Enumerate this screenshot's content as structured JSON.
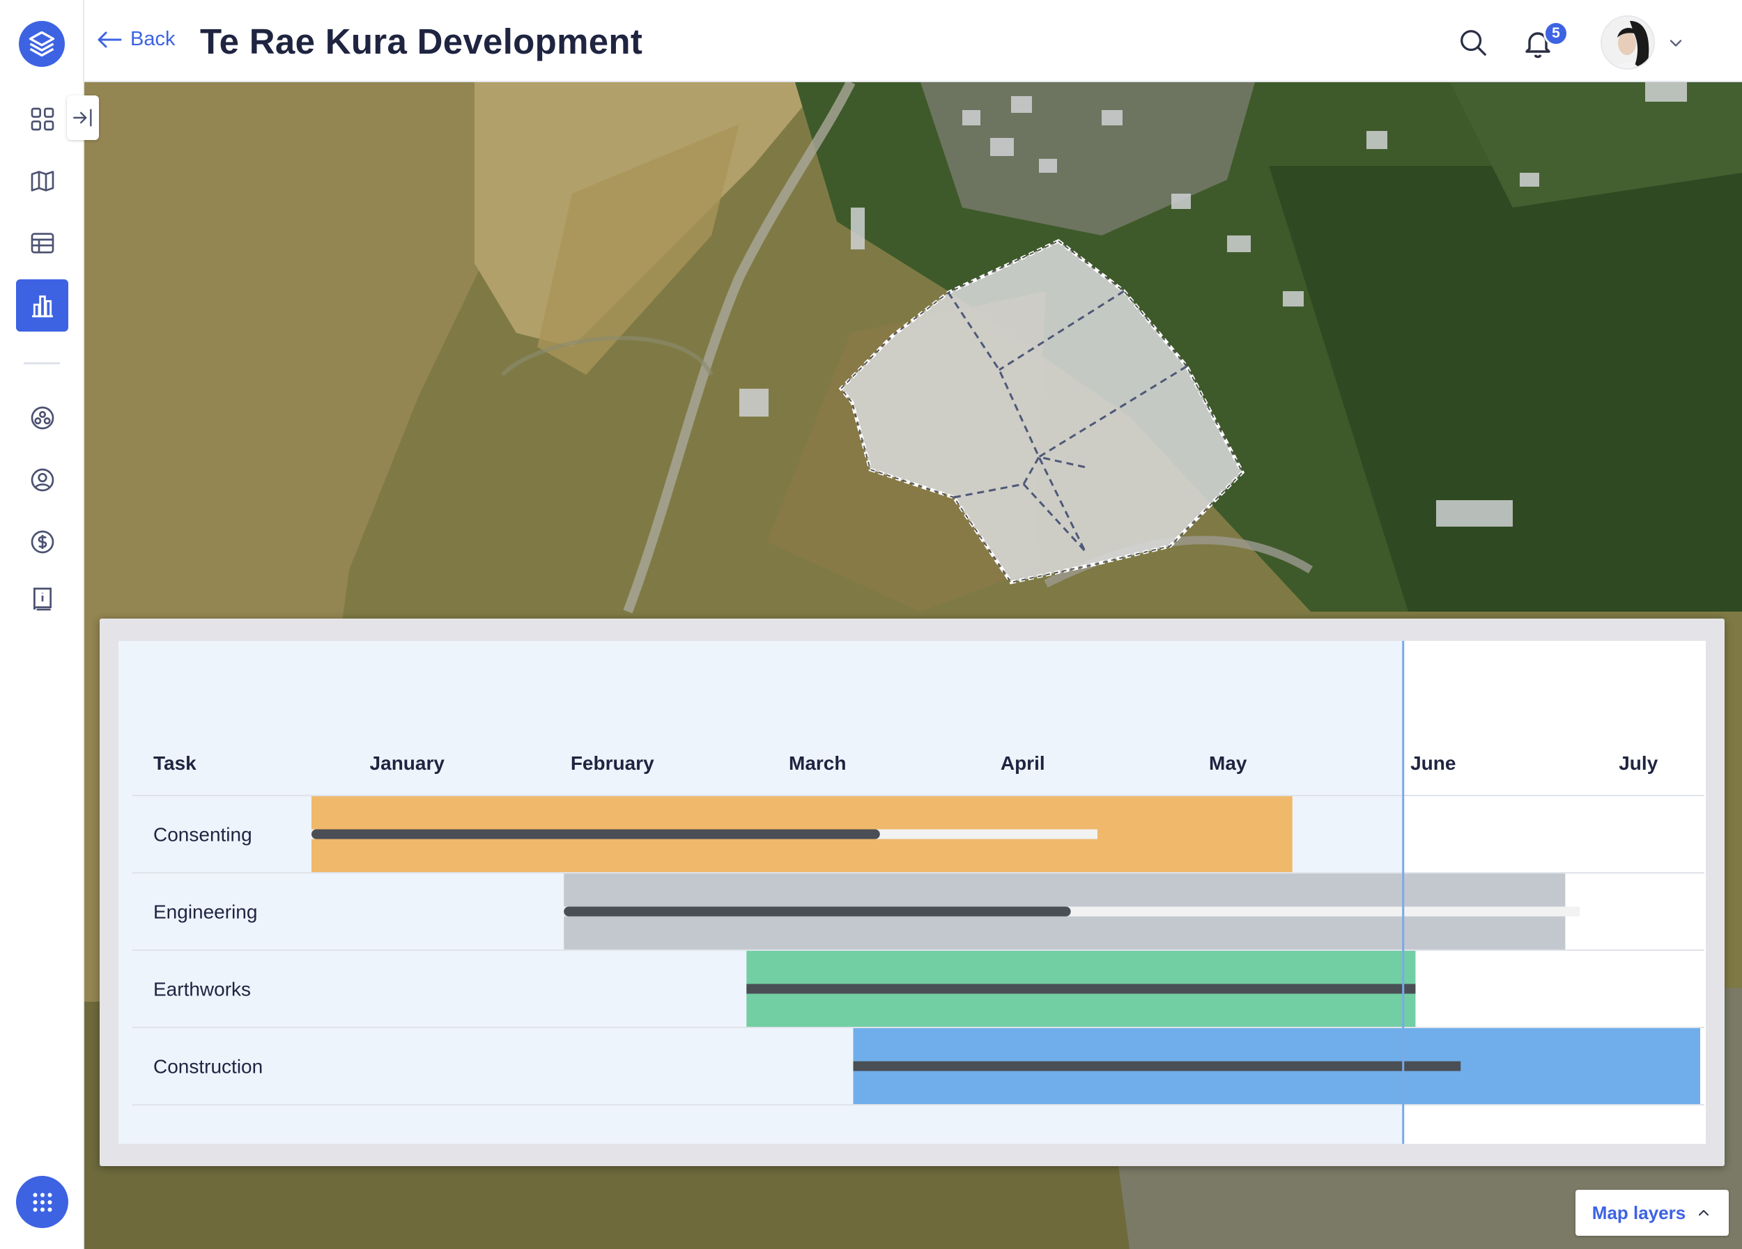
{
  "header": {
    "back_label": "Back",
    "title": "Te Rae Kura Development",
    "notifications_count": "5"
  },
  "sidebar": {
    "items": [
      {
        "icon": "dashboard-grid-icon"
      },
      {
        "icon": "map-icon"
      },
      {
        "icon": "table-icon"
      },
      {
        "icon": "bar-chart-icon",
        "active": true
      },
      {
        "icon": "team-icon"
      },
      {
        "icon": "user-profile-icon"
      },
      {
        "icon": "dollar-icon"
      },
      {
        "icon": "info-book-icon"
      }
    ],
    "accent": "#3d63e3"
  },
  "gantt": {
    "task_header": "Task",
    "months": [
      "January",
      "February",
      "March",
      "April",
      "May",
      "June",
      "July"
    ],
    "today_month_fraction": 5.32,
    "tasks": [
      {
        "name": "Consenting",
        "start": 0.0,
        "end": 4.78,
        "progress_end": 2.77,
        "track_end": 3.83,
        "color": "#efb86b",
        "track_color": "#f2f2f2"
      },
      {
        "name": "Engineering",
        "start": 1.23,
        "end": 6.11,
        "progress_end": 3.7,
        "track_end": 6.18,
        "color": "#c3c8cf",
        "track_color": "#f2f2f2"
      },
      {
        "name": "Earthworks",
        "start": 2.12,
        "end": 5.38,
        "progress_end": 5.38,
        "track_end": 5.38,
        "color": "#72cea3",
        "track_color": "#4a4e55"
      },
      {
        "name": "Construction",
        "start": 2.64,
        "end": 6.77,
        "progress_end": 5.6,
        "track_end": 5.6,
        "color": "#6faeea",
        "track_color": "#4a4e55"
      }
    ]
  },
  "map_layers_label": "Map layers"
}
